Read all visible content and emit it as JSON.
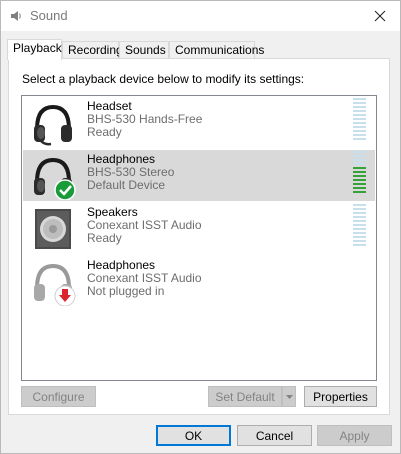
{
  "window": {
    "title": "Sound"
  },
  "tabs": [
    {
      "label": "Playback",
      "active": true
    },
    {
      "label": "Recording",
      "active": false
    },
    {
      "label": "Sounds",
      "active": false
    },
    {
      "label": "Communications",
      "active": false
    }
  ],
  "instruction": "Select a playback device below to modify its settings:",
  "devices": [
    {
      "name": "Headset",
      "model": "BHS-530 Hands-Free",
      "status": "Ready",
      "icon": "headset-icon",
      "level_segments_on": 0
    },
    {
      "name": "Headphones",
      "model": "BHS-530 Stereo",
      "status": "Default Device",
      "icon": "headphones-default-icon",
      "selected": true,
      "level_segments_on": 7
    },
    {
      "name": "Speakers",
      "model": "Conexant ISST Audio",
      "status": "Ready",
      "icon": "speakers-icon",
      "level_segments_on": 0
    },
    {
      "name": "Headphones",
      "model": "Conexant ISST Audio",
      "status": "Not plugged in",
      "icon": "headphones-unplugged-icon",
      "level_segments_on": 0
    }
  ],
  "buttons": {
    "configure": "Configure",
    "set_default": "Set Default",
    "properties": "Properties",
    "ok": "OK",
    "cancel": "Cancel",
    "apply": "Apply"
  },
  "colors": {
    "selection": "#d9d9d9",
    "level_on": "#36a33a",
    "level_off": "#c8e0ec",
    "default_check": "#1a9b3a",
    "unplugged_arrow": "#d9252b"
  }
}
